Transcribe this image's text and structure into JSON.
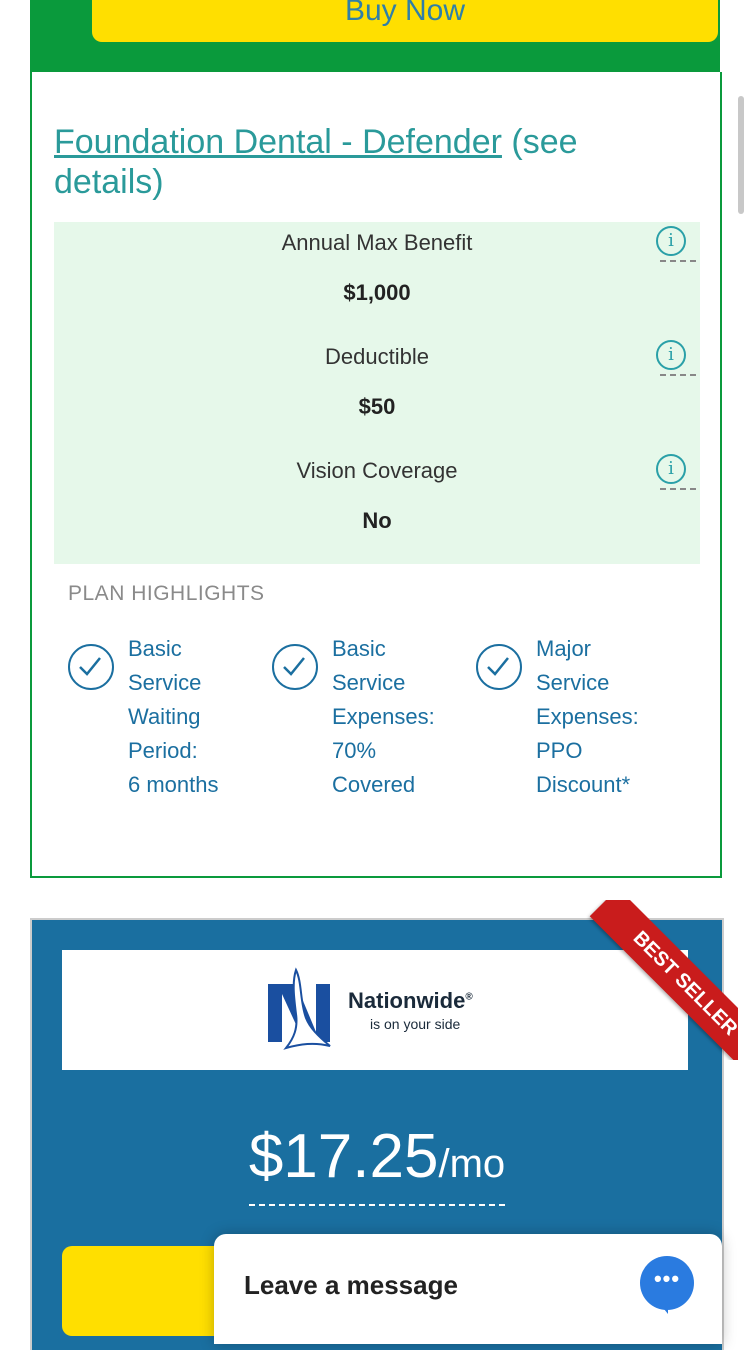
{
  "top_buy_button": {
    "label": "Buy Now"
  },
  "plan": {
    "title_link": "Foundation Dental - Defender",
    "title_suffix": "(see details)",
    "benefits": [
      {
        "label": "Annual Max Benefit",
        "value": "$1,000"
      },
      {
        "label": "Deductible",
        "value": "$50"
      },
      {
        "label": "Vision Coverage",
        "value": "No"
      }
    ],
    "info_icon_glyph": "i",
    "highlights_heading": "PLAN HIGHLIGHTS",
    "highlights": [
      {
        "line1": "Basic",
        "line2": "Service",
        "line3": "Waiting",
        "line4": "Period:",
        "line5": "6 months"
      },
      {
        "line1": "Basic",
        "line2": "Service",
        "line3": "Expenses:",
        "line4": "70%",
        "line5": "Covered"
      },
      {
        "line1": "Major",
        "line2": "Service",
        "line3": "Expenses:",
        "line4": "PPO",
        "line5": "Discount*"
      }
    ]
  },
  "nationwide": {
    "brand": "Nationwide",
    "registered": "®",
    "tagline": "is on your side",
    "ribbon": "BEST SELLER",
    "price_amount": "$17.25",
    "price_unit": "/mo"
  },
  "chat": {
    "label": "Leave a message",
    "dots": "•••"
  },
  "colors": {
    "green": "#0a9a3c",
    "yellow": "#ffdf00",
    "teal": "#2a9a9a",
    "blue": "#1a6fa0",
    "ribbon_red": "#c91c1c",
    "benefit_bg": "#e6f8ea"
  },
  "icons": {
    "info": "info-circle-icon",
    "check": "check-circle-icon",
    "chat": "chat-bubble-icon",
    "logo": "nationwide-eagle-logo"
  }
}
